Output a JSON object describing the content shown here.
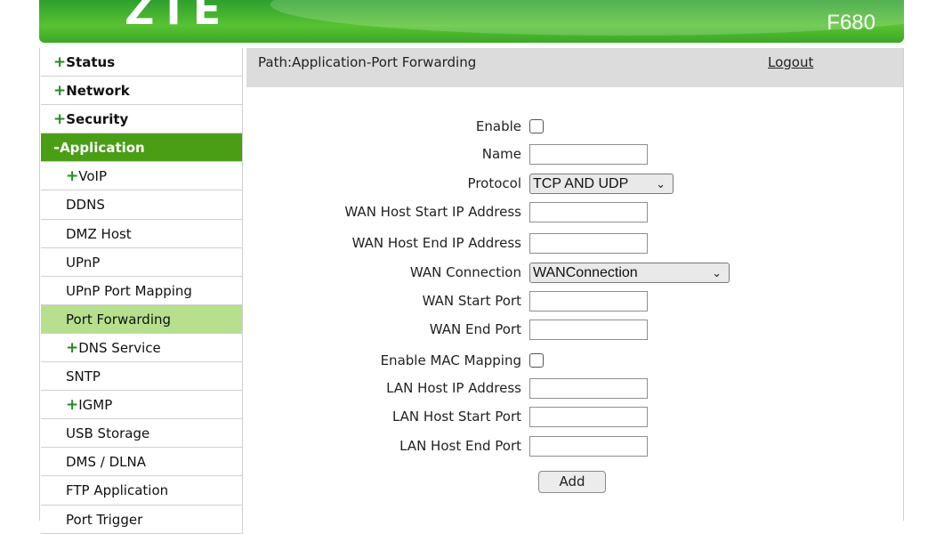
{
  "header": {
    "logo": "ZTE",
    "model": "F680"
  },
  "sidebar": {
    "items": [
      {
        "prefix": "+",
        "label": "Status"
      },
      {
        "prefix": "+",
        "label": "Network"
      },
      {
        "prefix": "+",
        "label": "Security"
      },
      {
        "prefix": "-",
        "label": "Application"
      },
      {
        "prefix": "+",
        "label": "VoIP"
      },
      {
        "prefix": "",
        "label": "DDNS"
      },
      {
        "prefix": "",
        "label": "DMZ Host"
      },
      {
        "prefix": "",
        "label": "UPnP"
      },
      {
        "prefix": "",
        "label": "UPnP Port Mapping"
      },
      {
        "prefix": "",
        "label": "Port Forwarding"
      },
      {
        "prefix": "+",
        "label": "DNS Service"
      },
      {
        "prefix": "",
        "label": "SNTP"
      },
      {
        "prefix": "+",
        "label": "IGMP"
      },
      {
        "prefix": "",
        "label": "USB Storage"
      },
      {
        "prefix": "",
        "label": "DMS / DLNA"
      },
      {
        "prefix": "",
        "label": "FTP Application"
      },
      {
        "prefix": "",
        "label": "Port Trigger"
      }
    ]
  },
  "pathbar": {
    "path": "Path:Application-Port Forwarding",
    "logout": "Logout"
  },
  "form": {
    "enable_label": "Enable",
    "name_label": "Name",
    "protocol_label": "Protocol",
    "protocol_value": "TCP AND UDP",
    "wan_host_start_label": "WAN Host Start IP Address",
    "wan_host_end_label": "WAN Host End IP Address",
    "wan_connection_label": "WAN Connection",
    "wan_connection_value": "WANConnection",
    "wan_start_port_label": "WAN Start Port",
    "wan_end_port_label": "WAN End Port",
    "enable_mac_label": "Enable MAC Mapping",
    "lan_host_ip_label": "LAN Host IP Address",
    "lan_host_start_port_label": "LAN Host Start Port",
    "lan_host_end_port_label": "LAN Host End Port",
    "add_label": "Add"
  },
  "colors": {
    "brand_green": "#4a9e16",
    "selected_green": "#b6e08e",
    "plus_green": "#1f8c1f"
  }
}
